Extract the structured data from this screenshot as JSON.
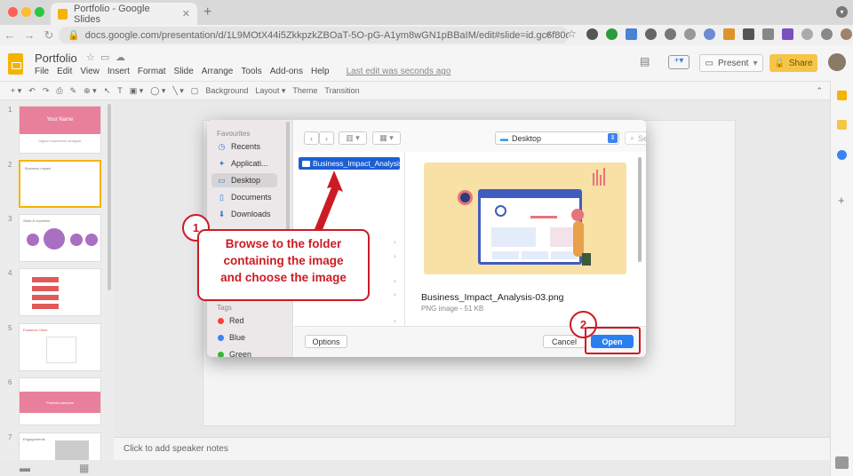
{
  "browser": {
    "tab_title": "Portfolio - Google Slides",
    "new_tab_glyph": "+",
    "url": "docs.google.com/presentation/d/1L9MOtX44i5ZkkpzkZBOaT-5O-pG-A1ym8wGN1pBBaIM/edit#slide=id.gc6f80d1f...",
    "traffic_lights": [
      "#fe5f57",
      "#febc2e",
      "#28c840"
    ]
  },
  "app": {
    "doc_title": "Portfolio",
    "menus": [
      "File",
      "Edit",
      "View",
      "Insert",
      "Format",
      "Slide",
      "Arrange",
      "Tools",
      "Add-ons",
      "Help"
    ],
    "last_edit": "Last edit was seconds ago",
    "present_label": "Present",
    "share_label": "Share",
    "toolbar_items": [
      "Background",
      "Layout ▾",
      "Theme",
      "Transition"
    ],
    "notes_placeholder": "Click to add speaker notes"
  },
  "filmstrip": {
    "slides": [
      {
        "num": "1",
        "title": "Your Name",
        "subtitle": "Digital experience designer"
      },
      {
        "num": "2",
        "title": "Business Impact",
        "subtitle": ""
      },
      {
        "num": "3",
        "title": "Skills & expertise",
        "subtitle": ""
      },
      {
        "num": "4",
        "title": "",
        "subtitle": ""
      },
      {
        "num": "5",
        "title": "Featured Client",
        "subtitle": ""
      },
      {
        "num": "6",
        "title": "Portfolio samples",
        "subtitle": ""
      },
      {
        "num": "7",
        "title": "Engagements",
        "subtitle": ""
      }
    ]
  },
  "dialog": {
    "favourites_heading": "Favourites",
    "favourites": [
      {
        "label": "Recents",
        "icon": "clock-icon"
      },
      {
        "label": "Applicati...",
        "icon": "applications-icon"
      },
      {
        "label": "Desktop",
        "icon": "desktop-icon"
      },
      {
        "label": "Documents",
        "icon": "document-icon"
      },
      {
        "label": "Downloads",
        "icon": "download-icon"
      }
    ],
    "tags_heading": "Tags",
    "tags": [
      {
        "label": "Red",
        "color": "#f5413c"
      },
      {
        "label": "Blue",
        "color": "#3d82f1"
      },
      {
        "label": "Green",
        "color": "#36b537"
      }
    ],
    "location": "Desktop",
    "search_placeholder": "Search",
    "selected_file": "Business_Impact_Analysis-03.png",
    "preview_name": "Business_Impact_Analysis-03.png",
    "preview_meta": "PNG image - 51 KB",
    "options_label": "Options",
    "cancel_label": "Cancel",
    "open_label": "Open"
  },
  "annotations": {
    "step1": "1",
    "step2": "2",
    "callout_line1": "Browse to the folder",
    "callout_line2": "containing the image",
    "callout_line3": "and choose the image",
    "color": "#cc1b24"
  }
}
